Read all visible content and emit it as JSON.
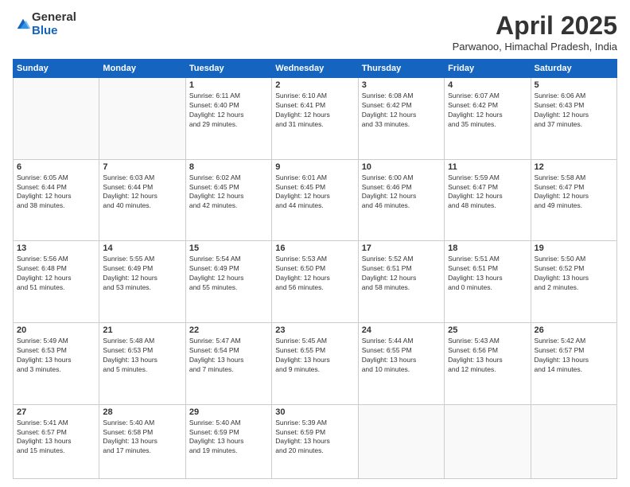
{
  "header": {
    "logo_general": "General",
    "logo_blue": "Blue",
    "title": "April 2025",
    "location": "Parwanoo, Himachal Pradesh, India"
  },
  "days_of_week": [
    "Sunday",
    "Monday",
    "Tuesday",
    "Wednesday",
    "Thursday",
    "Friday",
    "Saturday"
  ],
  "weeks": [
    [
      {
        "day": "",
        "info": ""
      },
      {
        "day": "",
        "info": ""
      },
      {
        "day": "1",
        "info": "Sunrise: 6:11 AM\nSunset: 6:40 PM\nDaylight: 12 hours\nand 29 minutes."
      },
      {
        "day": "2",
        "info": "Sunrise: 6:10 AM\nSunset: 6:41 PM\nDaylight: 12 hours\nand 31 minutes."
      },
      {
        "day": "3",
        "info": "Sunrise: 6:08 AM\nSunset: 6:42 PM\nDaylight: 12 hours\nand 33 minutes."
      },
      {
        "day": "4",
        "info": "Sunrise: 6:07 AM\nSunset: 6:42 PM\nDaylight: 12 hours\nand 35 minutes."
      },
      {
        "day": "5",
        "info": "Sunrise: 6:06 AM\nSunset: 6:43 PM\nDaylight: 12 hours\nand 37 minutes."
      }
    ],
    [
      {
        "day": "6",
        "info": "Sunrise: 6:05 AM\nSunset: 6:44 PM\nDaylight: 12 hours\nand 38 minutes."
      },
      {
        "day": "7",
        "info": "Sunrise: 6:03 AM\nSunset: 6:44 PM\nDaylight: 12 hours\nand 40 minutes."
      },
      {
        "day": "8",
        "info": "Sunrise: 6:02 AM\nSunset: 6:45 PM\nDaylight: 12 hours\nand 42 minutes."
      },
      {
        "day": "9",
        "info": "Sunrise: 6:01 AM\nSunset: 6:45 PM\nDaylight: 12 hours\nand 44 minutes."
      },
      {
        "day": "10",
        "info": "Sunrise: 6:00 AM\nSunset: 6:46 PM\nDaylight: 12 hours\nand 46 minutes."
      },
      {
        "day": "11",
        "info": "Sunrise: 5:59 AM\nSunset: 6:47 PM\nDaylight: 12 hours\nand 48 minutes."
      },
      {
        "day": "12",
        "info": "Sunrise: 5:58 AM\nSunset: 6:47 PM\nDaylight: 12 hours\nand 49 minutes."
      }
    ],
    [
      {
        "day": "13",
        "info": "Sunrise: 5:56 AM\nSunset: 6:48 PM\nDaylight: 12 hours\nand 51 minutes."
      },
      {
        "day": "14",
        "info": "Sunrise: 5:55 AM\nSunset: 6:49 PM\nDaylight: 12 hours\nand 53 minutes."
      },
      {
        "day": "15",
        "info": "Sunrise: 5:54 AM\nSunset: 6:49 PM\nDaylight: 12 hours\nand 55 minutes."
      },
      {
        "day": "16",
        "info": "Sunrise: 5:53 AM\nSunset: 6:50 PM\nDaylight: 12 hours\nand 56 minutes."
      },
      {
        "day": "17",
        "info": "Sunrise: 5:52 AM\nSunset: 6:51 PM\nDaylight: 12 hours\nand 58 minutes."
      },
      {
        "day": "18",
        "info": "Sunrise: 5:51 AM\nSunset: 6:51 PM\nDaylight: 13 hours\nand 0 minutes."
      },
      {
        "day": "19",
        "info": "Sunrise: 5:50 AM\nSunset: 6:52 PM\nDaylight: 13 hours\nand 2 minutes."
      }
    ],
    [
      {
        "day": "20",
        "info": "Sunrise: 5:49 AM\nSunset: 6:53 PM\nDaylight: 13 hours\nand 3 minutes."
      },
      {
        "day": "21",
        "info": "Sunrise: 5:48 AM\nSunset: 6:53 PM\nDaylight: 13 hours\nand 5 minutes."
      },
      {
        "day": "22",
        "info": "Sunrise: 5:47 AM\nSunset: 6:54 PM\nDaylight: 13 hours\nand 7 minutes."
      },
      {
        "day": "23",
        "info": "Sunrise: 5:45 AM\nSunset: 6:55 PM\nDaylight: 13 hours\nand 9 minutes."
      },
      {
        "day": "24",
        "info": "Sunrise: 5:44 AM\nSunset: 6:55 PM\nDaylight: 13 hours\nand 10 minutes."
      },
      {
        "day": "25",
        "info": "Sunrise: 5:43 AM\nSunset: 6:56 PM\nDaylight: 13 hours\nand 12 minutes."
      },
      {
        "day": "26",
        "info": "Sunrise: 5:42 AM\nSunset: 6:57 PM\nDaylight: 13 hours\nand 14 minutes."
      }
    ],
    [
      {
        "day": "27",
        "info": "Sunrise: 5:41 AM\nSunset: 6:57 PM\nDaylight: 13 hours\nand 15 minutes."
      },
      {
        "day": "28",
        "info": "Sunrise: 5:40 AM\nSunset: 6:58 PM\nDaylight: 13 hours\nand 17 minutes."
      },
      {
        "day": "29",
        "info": "Sunrise: 5:40 AM\nSunset: 6:59 PM\nDaylight: 13 hours\nand 19 minutes."
      },
      {
        "day": "30",
        "info": "Sunrise: 5:39 AM\nSunset: 6:59 PM\nDaylight: 13 hours\nand 20 minutes."
      },
      {
        "day": "",
        "info": ""
      },
      {
        "day": "",
        "info": ""
      },
      {
        "day": "",
        "info": ""
      }
    ]
  ]
}
